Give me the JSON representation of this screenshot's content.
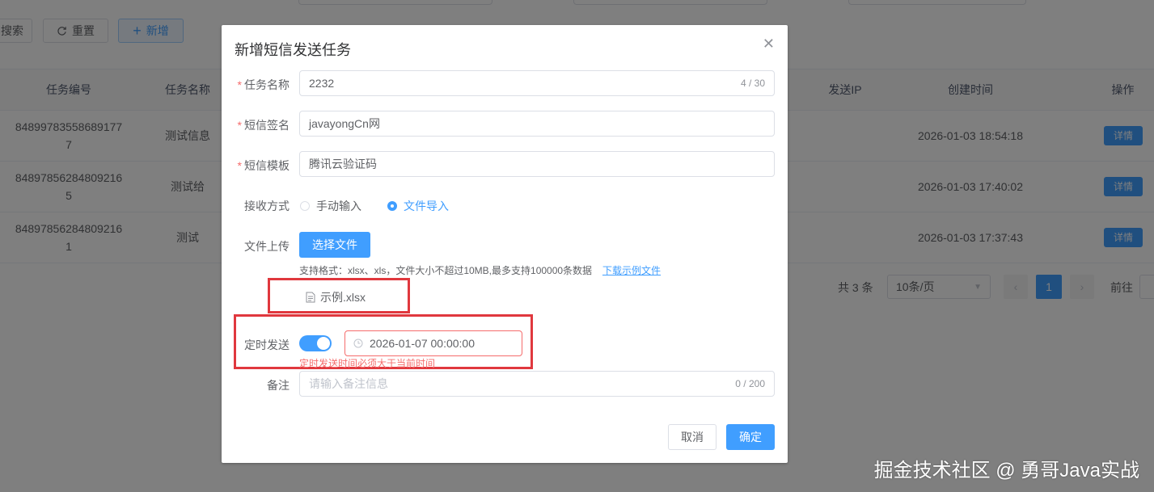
{
  "toolbar": {
    "search_label": "搜索",
    "reset_label": "重置",
    "add_label": "新增"
  },
  "table": {
    "headers": [
      "任务编号",
      "任务名称",
      "发送IP",
      "创建时间",
      "操作"
    ],
    "rows": [
      {
        "id": "848997835586891777",
        "name": "测试信息",
        "created": "2026-01-03 18:54:18",
        "action": "详情"
      },
      {
        "id": "848978562848092165",
        "name": "测试给",
        "created": "2026-01-03 17:40:02",
        "action": "详情"
      },
      {
        "id": "848978562848092161",
        "name": "测试",
        "created": "2026-01-03 17:37:43",
        "action": "详情"
      }
    ]
  },
  "pagination": {
    "total_text": "共 3 条",
    "page_size": "10条/页",
    "current_page": "1",
    "goto_label": "前往"
  },
  "dialog": {
    "title": "新增短信发送任务",
    "task_name": {
      "label": "任务名称",
      "value": "2232",
      "count": "4 / 30"
    },
    "signature": {
      "label": "短信签名",
      "value": "javayongCn网"
    },
    "template": {
      "label": "短信模板",
      "value": "腾讯云验证码"
    },
    "receive": {
      "label": "接收方式",
      "options": [
        "手动输入",
        "文件导入"
      ],
      "selected": "文件导入"
    },
    "upload": {
      "label": "文件上传",
      "button": "选择文件",
      "tip": "支持格式：xlsx、xls，文件大小不超过10MB,最多支持100000条数据",
      "download_link": "下载示例文件",
      "file_name": "示例.xlsx"
    },
    "schedule": {
      "label": "定时发送",
      "enabled": true,
      "datetime": "2026-01-07 00:00:00",
      "error": "定时发送时间必须大于当前时间"
    },
    "remark": {
      "label": "备注",
      "placeholder": "请输入备注信息",
      "count": "0 / 200"
    },
    "cancel_label": "取消",
    "confirm_label": "确定"
  },
  "watermark": "掘金技术社区 @ 勇哥Java实战",
  "colors": {
    "primary": "#409eff",
    "danger": "#f56c6c",
    "highlight_box": "#e0383e"
  }
}
